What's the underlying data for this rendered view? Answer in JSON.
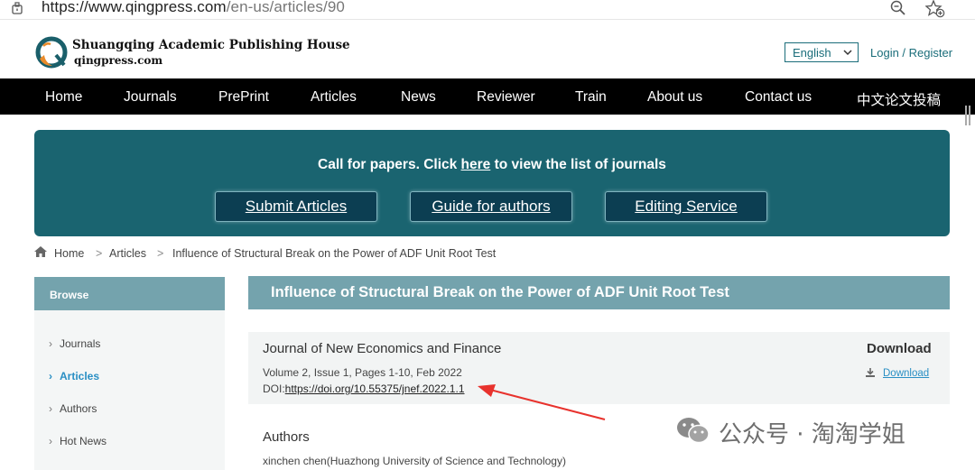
{
  "browser": {
    "url_prefix": "https://www.",
    "url_host": "qingpress.com",
    "url_path": "/en-us/articles/90"
  },
  "header": {
    "logo_title": "Shuangqing Academic Publishing House",
    "logo_sub": "qingpress.com",
    "language": "English",
    "login": "Login / Register"
  },
  "nav": {
    "items": [
      "Home",
      "Journals",
      "PrePrint",
      "Articles",
      "News",
      "Reviewer",
      "Train",
      "About us",
      "Contact us",
      "中文论文投稿"
    ]
  },
  "banner": {
    "text_before": "Call for papers. Click ",
    "text_link": "here",
    "text_after": " to view the list of journals",
    "buttons": [
      "Submit Articles",
      "Guide for authors",
      "Editing Service"
    ]
  },
  "breadcrumb": {
    "home": "Home",
    "sep": ">",
    "articles": "Articles",
    "current": "Influence of Structural Break on the Power of ADF Unit Root Test"
  },
  "sidebar": {
    "title": "Browse",
    "items": [
      "Journals",
      "Articles",
      "Authors",
      "Hot News"
    ]
  },
  "article": {
    "title": "Influence of Structural Break on the Power of ADF Unit Root Test",
    "journal": "Journal of New Economics and Finance",
    "volume": "Volume 2, Issue 1, Pages 1-10, Feb 2022",
    "doi_label": "DOI:",
    "doi": "https://doi.org/10.55375/jnef.2022.1.1",
    "download_heading": "Download",
    "download_link": "Download",
    "authors_heading": "Authors",
    "author": "xinchen chen(Huazhong University of Science and Technology)"
  },
  "watermark": {
    "text": "公众号 · 淘淘学姐"
  },
  "colors": {
    "accent": "#1a6d7a",
    "banner": "#1a6470",
    "panel_head": "#74a3ad",
    "link": "#2a8fc4",
    "annotation": "#e8322d"
  }
}
